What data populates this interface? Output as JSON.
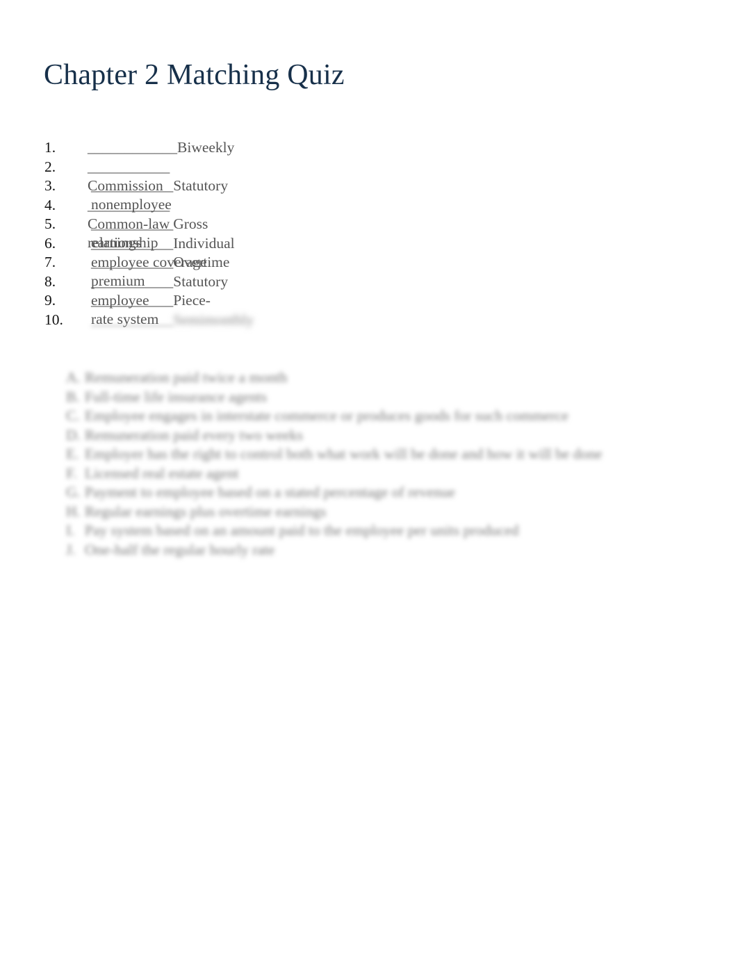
{
  "document": {
    "title": "Chapter 2 Matching Quiz",
    "blank": "___________",
    "terms": [
      {
        "number": "1.",
        "label": "Biweekly",
        "blurred": false
      },
      {
        "number": "2.",
        "label": " Commission",
        "blurred": false
      },
      {
        "number": "3.",
        "label": "Statutory nonemployee",
        "blurred": false
      },
      {
        "number": "4.",
        "label": " Common-law relationship",
        "blurred": false
      },
      {
        "number": "5.",
        "label": "Gross earnings",
        "blurred": false
      },
      {
        "number": "6.",
        "label": "Individual employee coverage",
        "blurred": false
      },
      {
        "number": "7.",
        "label": "Overtime premium",
        "blurred": false
      },
      {
        "number": "8.",
        "label": "Statutory employee",
        "blurred": false
      },
      {
        "number": "9.",
        "label": "Piece-rate system",
        "blurred": false
      },
      {
        "number": "10.",
        "label": "Semimonthly",
        "blurred": true
      }
    ],
    "definitions": [
      {
        "letter": "A.",
        "text": "Remuneration paid twice a month"
      },
      {
        "letter": "B.",
        "text": "Full-time life insurance agents"
      },
      {
        "letter": "C.",
        "text": "Employee engages in interstate commerce or produces goods for such commerce"
      },
      {
        "letter": "D.",
        "text": "Remuneration paid every two weeks"
      },
      {
        "letter": "E.",
        "text": "Employer has the right to control both what work will be done and how it will be done"
      },
      {
        "letter": "F.",
        "text": "Licensed real estate agent"
      },
      {
        "letter": "G.",
        "text": "Payment to employee based on a stated percentage of revenue"
      },
      {
        "letter": "H.",
        "text": "Regular earnings plus overtime earnings"
      },
      {
        "letter": "I.",
        "text": "Pay system based on an amount paid to the employee per units produced"
      },
      {
        "letter": "J.",
        "text": "One-half the regular hourly rate"
      }
    ]
  }
}
